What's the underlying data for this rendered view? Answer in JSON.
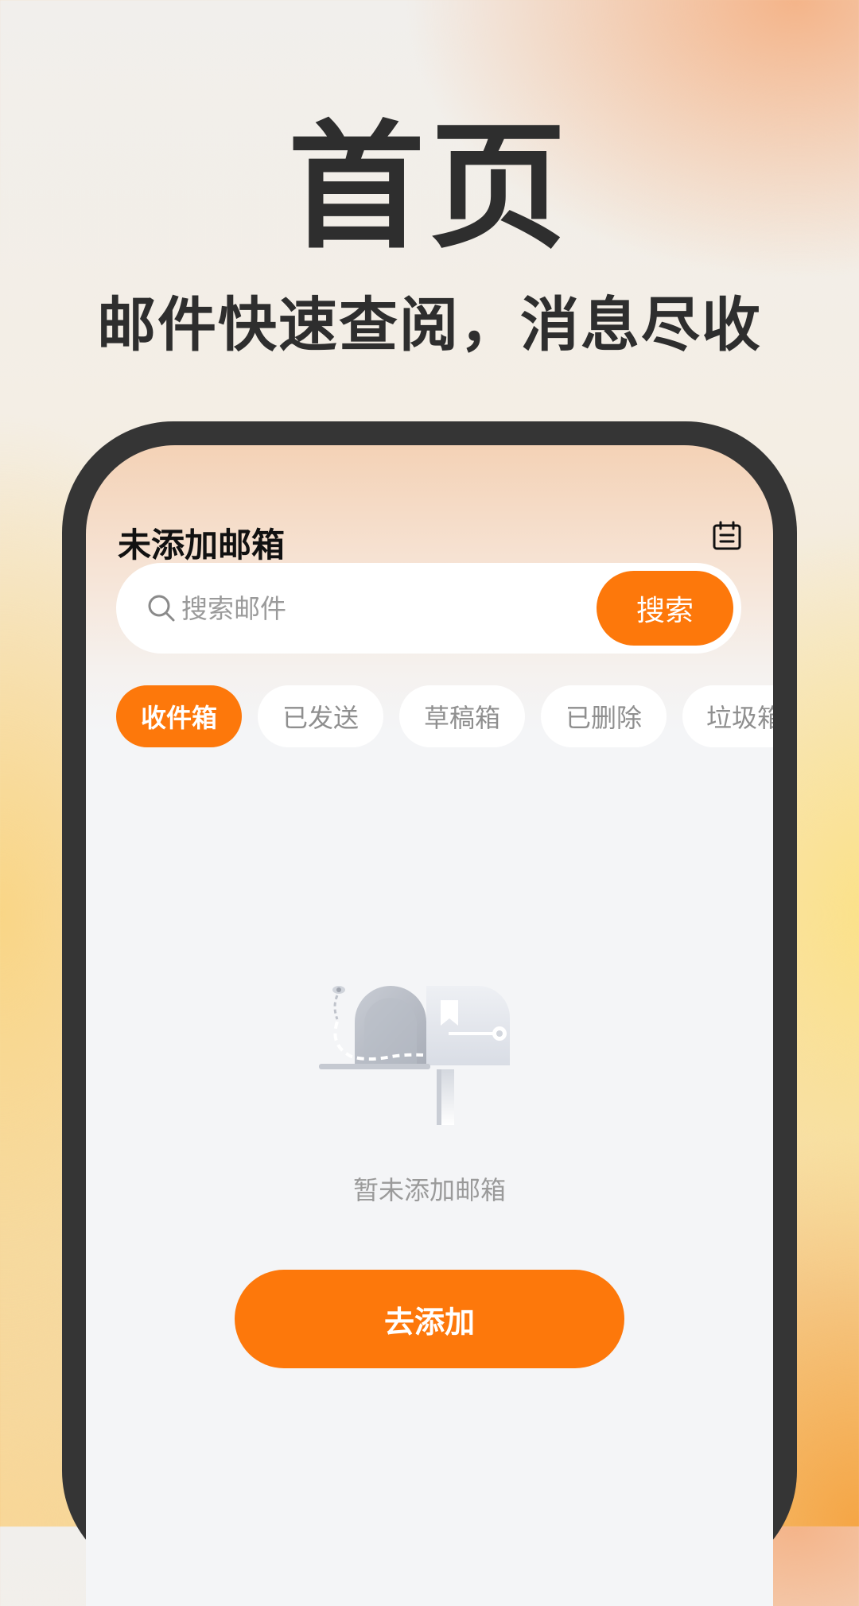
{
  "promo": {
    "headline": "首页",
    "subline": "邮件快速查阅，消息尽收"
  },
  "app": {
    "title": "未添加邮箱",
    "search": {
      "placeholder": "搜索邮件",
      "value": "",
      "button_label": "搜索"
    },
    "tabs": [
      {
        "label": "收件箱",
        "active": true
      },
      {
        "label": "已发送",
        "active": false
      },
      {
        "label": "草稿箱",
        "active": false
      },
      {
        "label": "已删除",
        "active": false
      },
      {
        "label": "垃圾箱",
        "active": false
      }
    ],
    "empty_state": {
      "icon": "mailbox-illustration",
      "message": "暂未添加邮箱",
      "action_label": "去添加"
    }
  },
  "icons": {
    "top_right": "calendar-icon",
    "search": "search-icon"
  },
  "colors": {
    "accent": "#fd780b",
    "text_dark": "#2e2e2e",
    "muted": "#9a9a9a",
    "phone_frame": "#353535",
    "screen_bg": "#f4f5f7"
  }
}
